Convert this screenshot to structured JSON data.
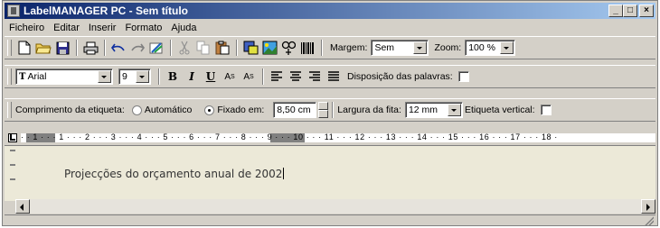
{
  "window": {
    "title": "LabelMANAGER PC - Sem título"
  },
  "title_buttons": {
    "minimize": "_",
    "maximize": "□",
    "close": "×"
  },
  "menu": [
    "Ficheiro",
    "Editar",
    "Inserir",
    "Formato",
    "Ajuda"
  ],
  "toolbar1": {
    "icons": [
      "new-document-icon",
      "open-folder-icon",
      "save-icon",
      "print-icon",
      "undo-icon",
      "redo-icon",
      "draw-icon",
      "cut-icon",
      "copy-icon",
      "paste-icon",
      "insert-image-icon",
      "insert-picture-icon",
      "symbol-icon",
      "barcode-icon"
    ],
    "margem_label": "Margem:",
    "margem_value": "Sem",
    "zoom_label": "Zoom:",
    "zoom_value": "100 %"
  },
  "toolbar2": {
    "font_value": "Arial",
    "size_value": "9",
    "bold": "B",
    "italic": "I",
    "underline": "U",
    "superscript": "A",
    "superscript_mark": "S",
    "subscript": "A",
    "subscript_mark": "S",
    "wrap_label": "Disposição das palavras:"
  },
  "toolbar3": {
    "length_label": "Comprimento da etiqueta:",
    "auto_label": "Automático",
    "fixed_label": "Fixado em:",
    "fixed_value": "8,50 cm",
    "tape_label": "Largura da fita:",
    "tape_value": "12 mm",
    "vertical_label": "Etiqueta vertical:"
  },
  "ruler": {
    "text": "· · 1 · · · 1 · · · 2 · · · 3 · · · 4 · · · 5 · · · 6 · · · 7 · · · 8 · · · 9 · · · 10 · · · 11 · · · 12 · · · 13 · · · 14 · · · 15 · · · 16 · · · 17 · · · 18 ·"
  },
  "label_text": "Projecções do orçamento anual de 2002",
  "colors": {
    "title_start": "#0a246a",
    "title_end": "#a6caf0",
    "face": "#d4d0c8"
  }
}
